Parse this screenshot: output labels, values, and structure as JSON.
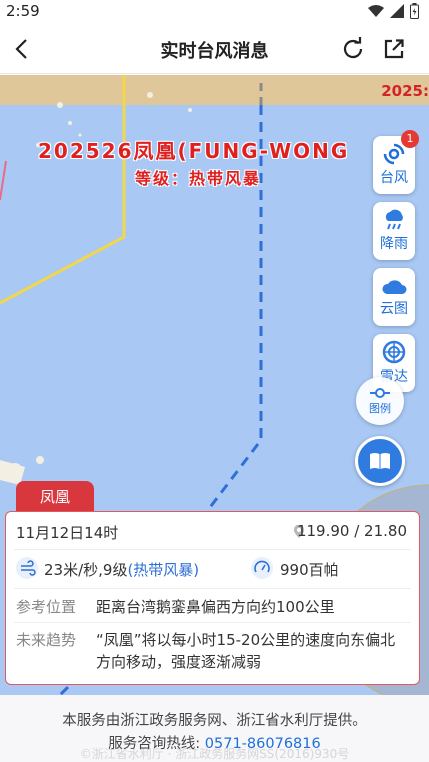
{
  "status_bar": {
    "time": "2:59",
    "icons": [
      "wifi-icon",
      "signal-icon",
      "battery-icon"
    ]
  },
  "nav": {
    "title": "实时台风消息",
    "icons": [
      "back-icon",
      "refresh-icon",
      "share-icon"
    ]
  },
  "map": {
    "ticker": "2025:",
    "typhoon_name": "202526凤凰(FUNG-WONG",
    "typhoon_level": "等级：热带风暴",
    "side_buttons": [
      {
        "label": "台风",
        "icon": "typhoon-icon",
        "badge": "1"
      },
      {
        "label": "降雨",
        "icon": "rain-icon"
      },
      {
        "label": "云图",
        "icon": "cloud-icon"
      },
      {
        "label": "雷达",
        "icon": "radar-icon"
      }
    ],
    "legend_label": "图例",
    "colors": {
      "sea": "#a9c9f4",
      "land": "#dfc79a",
      "track_forecast": "#2f6fd6",
      "warning_line": "#f2d64b",
      "accent": "#d9373e"
    }
  },
  "card": {
    "tab_label": "凤凰",
    "time": "11月12日14时",
    "coords": "119.90 / 21.80",
    "wind": "23米/秒,9级",
    "wind_level": "(热带风暴)",
    "pressure": "990百帕",
    "ref_label": "参考位置",
    "ref_value": "距离台湾鹅銮鼻偏西方向约100公里",
    "trend_label": "未来趋势",
    "trend_value": "“凤凰”将以每小时15-20公里的速度向东偏北方向移动，强度逐渐减弱"
  },
  "footer": {
    "line1": "本服务由浙江政务服务网、浙江省水利厅提供。",
    "line2_prefix": "服务咨询热线:",
    "hotline": "0571-86076816",
    "watermark": "©浙江省水利厅 · 浙江政务服务网SS(2016)930号"
  }
}
